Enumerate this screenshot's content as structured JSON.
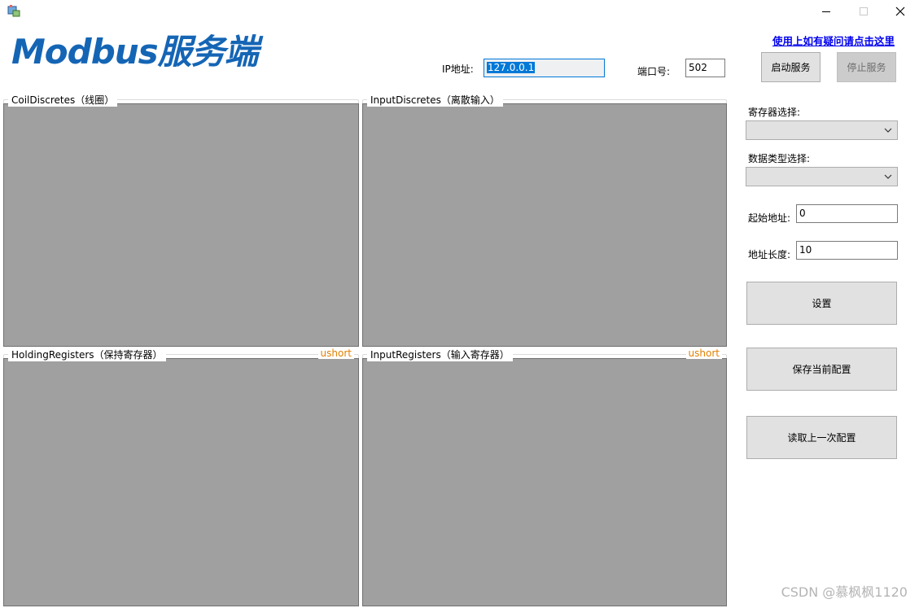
{
  "window": {
    "icon": "app-icon",
    "controls": [
      "minimize-icon",
      "maximize-icon",
      "close-icon"
    ]
  },
  "header": {
    "title": "Modbus服务端",
    "help_link": "使用上如有疑问请点击这里",
    "ip_label": "IP地址:",
    "ip_value": "127.0.0.1",
    "port_label": "端口号:",
    "port_value": "502",
    "start_button": "启动服务",
    "stop_button": "停止服务"
  },
  "groups": {
    "coils": {
      "title": "CoilDiscretes（线圈）"
    },
    "inputs": {
      "title": "InputDiscretes（离散输入）"
    },
    "holding": {
      "title": "HoldingRegisters（保持寄存器）",
      "data_type": "ushort"
    },
    "input_registers": {
      "title": "InputRegisters（输入寄存器）",
      "data_type": "ushort"
    }
  },
  "settings": {
    "register_label": "寄存器选择:",
    "register_value": "",
    "datatype_label": "数据类型选择:",
    "datatype_value": "",
    "start_address_label": "起始地址:",
    "start_address_value": "0",
    "length_label": "地址长度:",
    "length_value": "10",
    "set_button": "设置",
    "save_button": "保存当前配置",
    "load_button": "读取上一次配置"
  },
  "watermark": "CSDN @慕枫枫1120",
  "colors": {
    "title_blue": "#1565b5",
    "link_blue": "#0000ee",
    "dtype_orange": "#e08000",
    "panel_gray": "#a0a0a0"
  }
}
